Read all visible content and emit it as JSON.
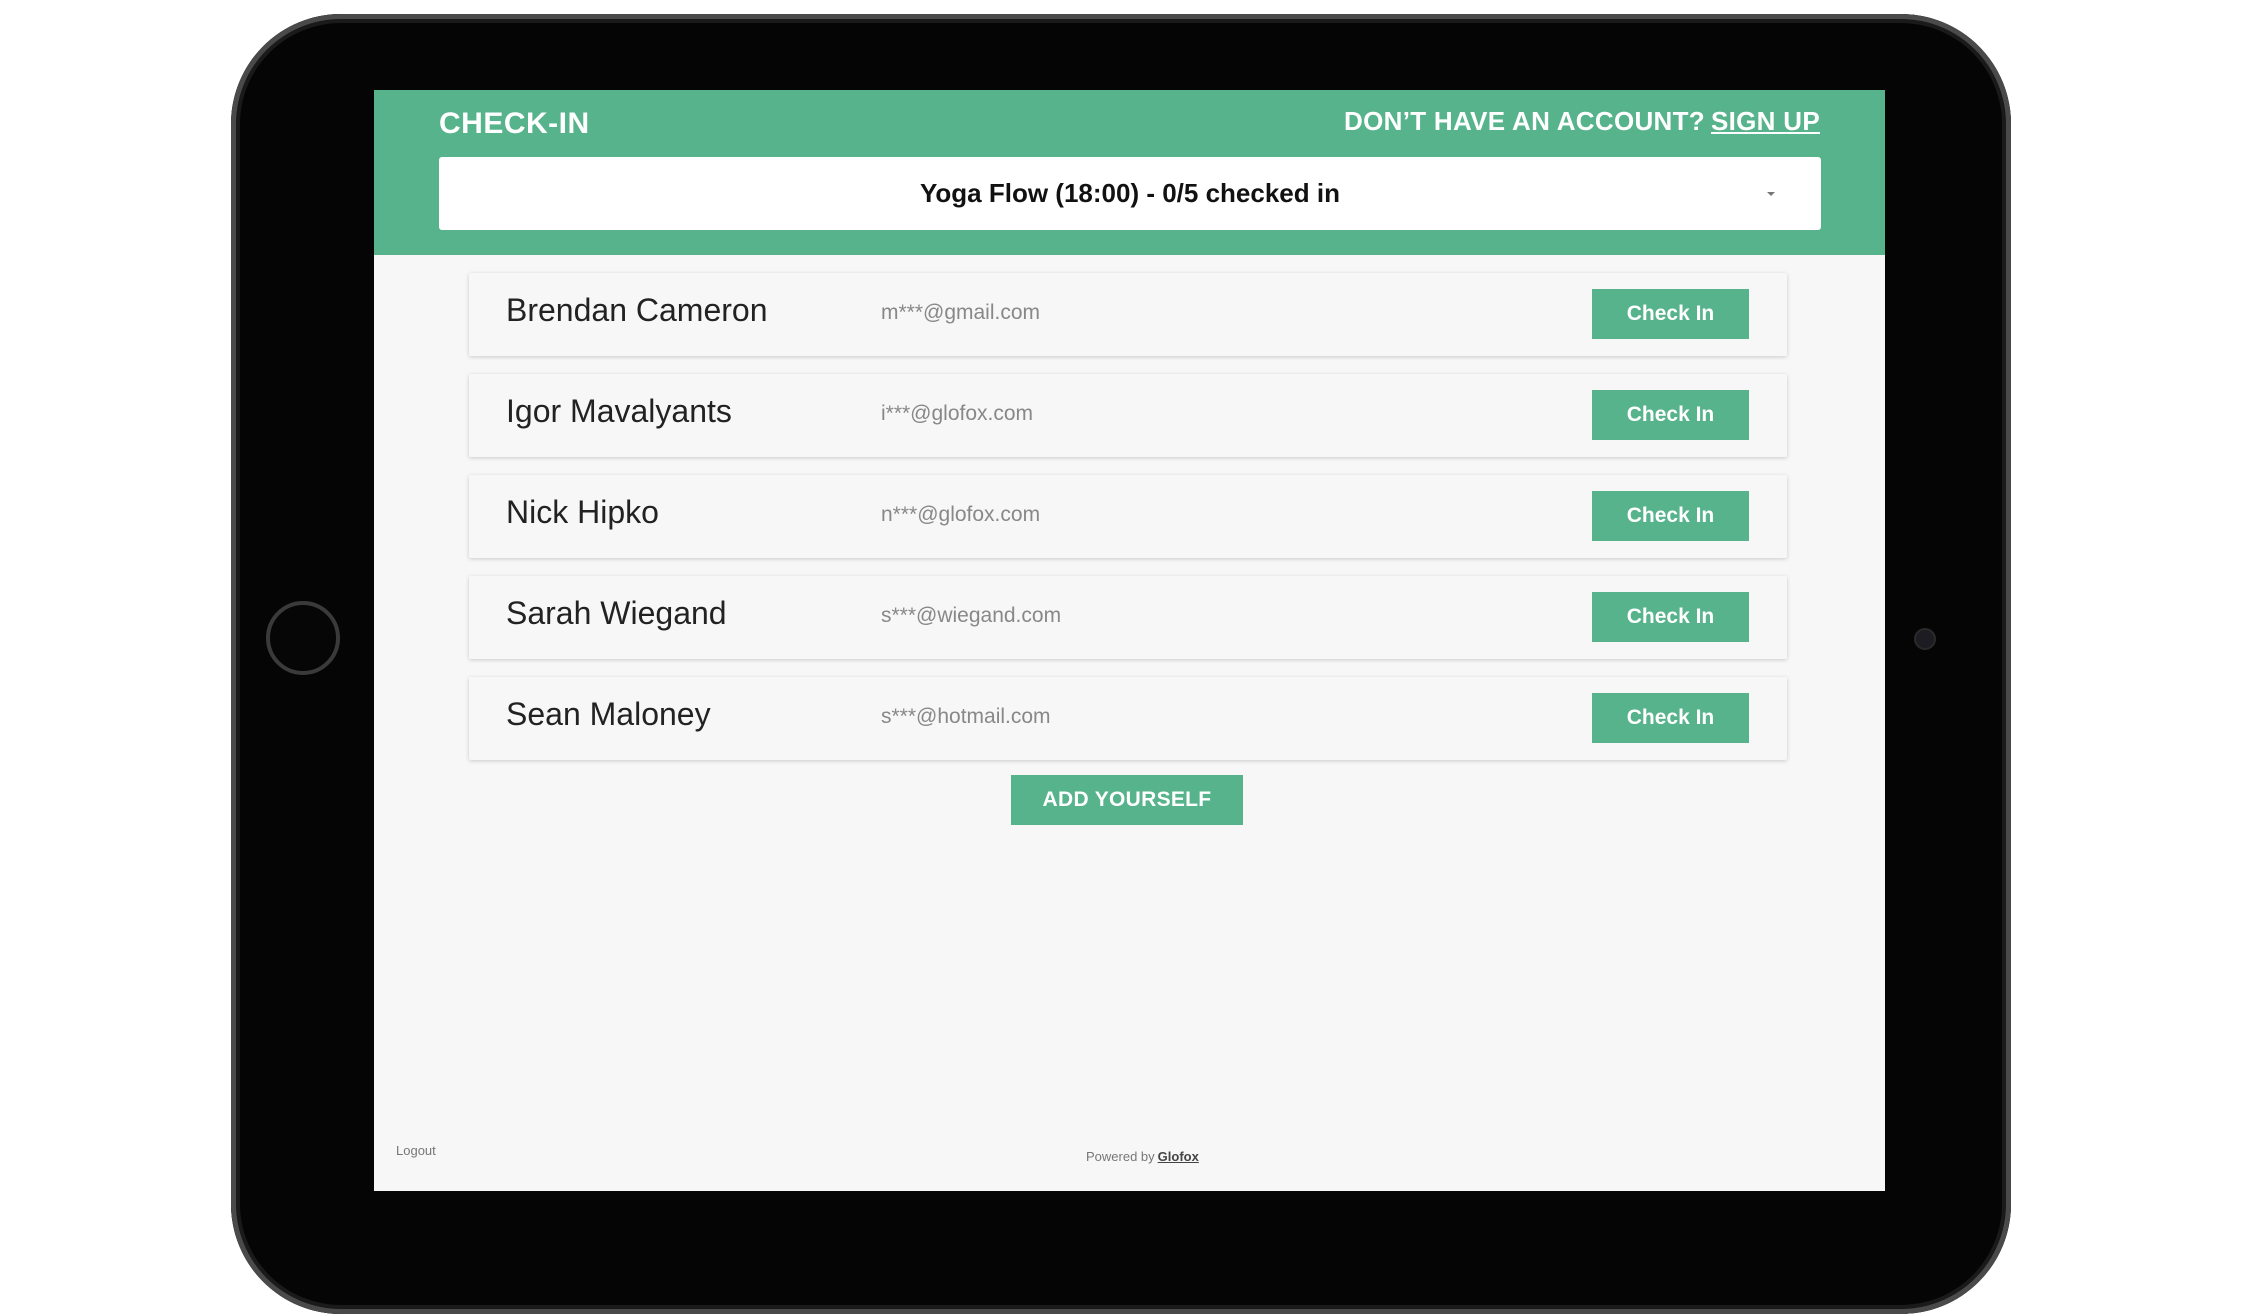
{
  "header": {
    "title": "CHECK-IN",
    "signup_prompt": "DON’T HAVE AN ACCOUNT?",
    "signup_link": "SIGN UP"
  },
  "class_select": {
    "selected": "Yoga Flow (18:00) - 0/5 checked in"
  },
  "members": [
    {
      "name": "Brendan Cameron",
      "email": "m***@gmail.com",
      "action": "Check In"
    },
    {
      "name": "Igor Mavalyants",
      "email": "i***@glofox.com",
      "action": "Check In"
    },
    {
      "name": "Nick Hipko",
      "email": "n***@glofox.com",
      "action": "Check In"
    },
    {
      "name": "Sarah Wiegand",
      "email": "s***@wiegand.com",
      "action": "Check In"
    },
    {
      "name": "Sean Maloney",
      "email": "s***@hotmail.com",
      "action": "Check In"
    }
  ],
  "add_yourself_label": "ADD YOURSELF",
  "footer": {
    "logout": "Logout",
    "powered_by": "Powered by",
    "brand": "Glofox"
  },
  "colors": {
    "accent": "#56b38b",
    "background": "#f7f7f7"
  }
}
